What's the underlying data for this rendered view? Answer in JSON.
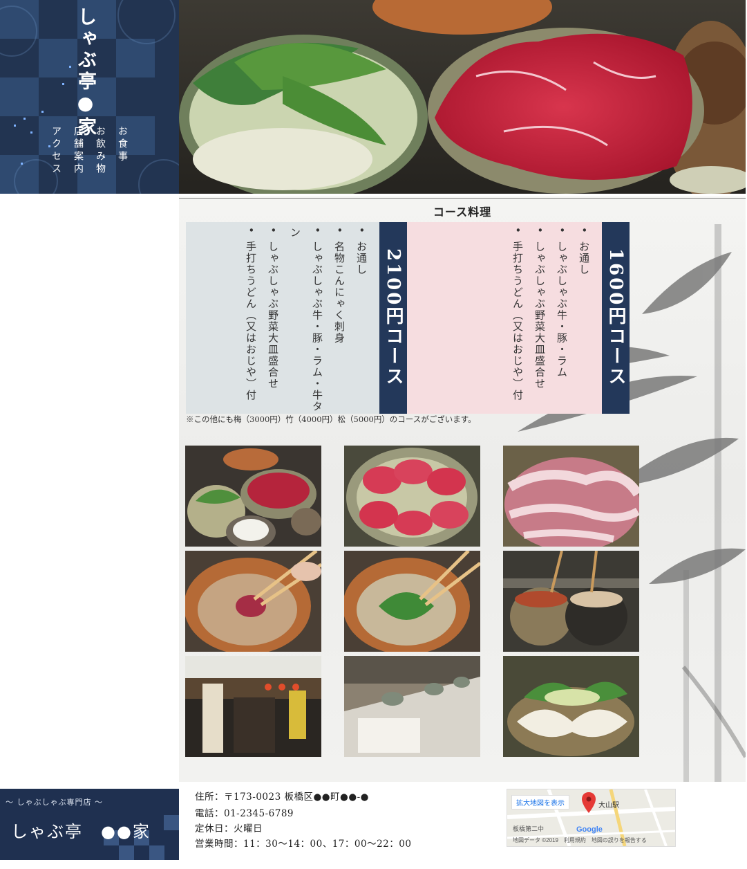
{
  "nav": {
    "brand": "しゃぶ亭●家",
    "items": [
      "お食事",
      "お飲み物",
      "店舗案内",
      "アクセス"
    ]
  },
  "main": {
    "section_title": "コース料理",
    "courses": [
      {
        "name": "1600円コース",
        "items": [
          "お通し",
          "しゃぶしゃぶ牛・豚・ラム",
          "しゃぶしゃぶ野菜大皿盛合せ",
          "手打ちうどん（又はおじや）付"
        ]
      },
      {
        "name": "2100円コース",
        "items": [
          "お通し",
          "名物こんにゃく刺身",
          "しゃぶしゃぶ牛・豚・ラム・牛タン",
          "しゃぶしゃぶ野菜大皿盛合せ",
          "手打ちうどん（又はおじや）付"
        ]
      }
    ],
    "note": "※この他にも梅（3000円）竹（4000円）松（5000円）のコースがございます。"
  },
  "footer": {
    "tagline": "〜 しゃぶしゃぶ専門店 〜",
    "name": "しゃぶ亭　●●家",
    "address": "住所：〒173-0023 板橋区●●町●●-●",
    "phone": "電話：01-2345-6789",
    "closed": "定休日：火曜日",
    "hours": "営業時間：11：30〜14：00、17：00〜22：00"
  },
  "map": {
    "link_text": "拡大地図を表示",
    "station": "大山駅",
    "place": "板橋第二中",
    "google": "Google",
    "attribution": "地図データ ©2019　利用規約　地図の誤りを報告する"
  },
  "colors": {
    "navy": "#223451",
    "course_header": "#23385a",
    "panel_blue": "#dde3e5",
    "panel_pink": "#f6dde0",
    "map_pin": "#e53935"
  }
}
